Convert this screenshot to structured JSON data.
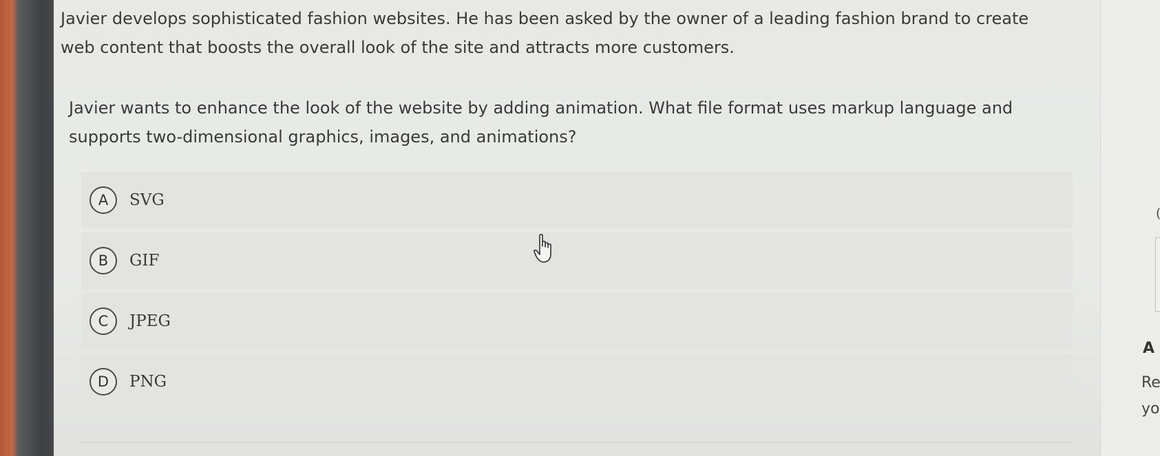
{
  "question": {
    "paragraph1": "Javier develops sophisticated fashion websites. He has been asked by the owner of a leading fashion brand to create web content that boosts the overall look of the site and attracts more customers.",
    "paragraph2": "Javier wants to enhance the look of the website by adding animation. What file format uses markup language and supports two-dimensional graphics, images, and animations?"
  },
  "choices": [
    {
      "letter": "A",
      "label": "SVG"
    },
    {
      "letter": "B",
      "label": "GIF"
    },
    {
      "letter": "C",
      "label": "JPEG"
    },
    {
      "letter": "D",
      "label": "PNG"
    }
  ],
  "side_panel": {
    "paren": "(",
    "heading_fragment": "A",
    "line1_fragment": "Re",
    "line2_fragment": "yo"
  },
  "icons": {
    "cursor": "hand-pointer-icon"
  }
}
